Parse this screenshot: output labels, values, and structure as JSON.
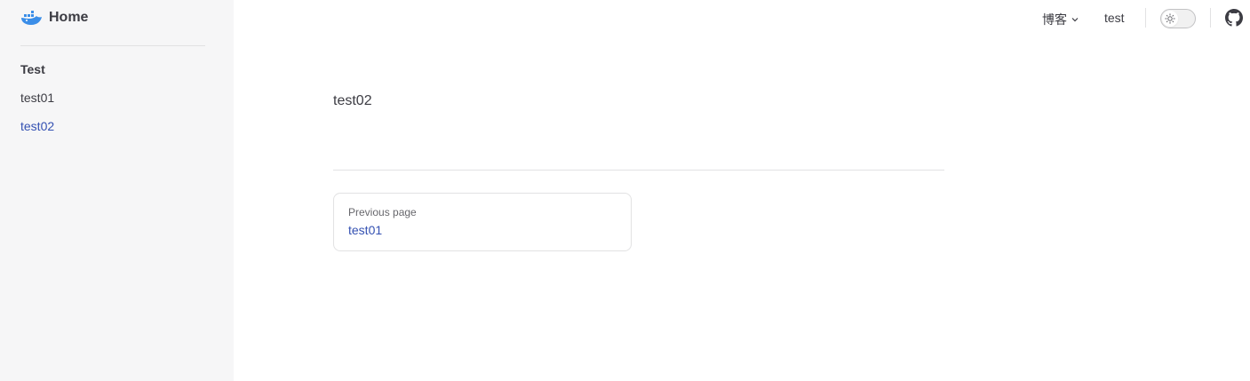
{
  "sidebar": {
    "logo_text": "Home",
    "group_title": "Test",
    "items": [
      {
        "label": "test01"
      },
      {
        "label": "test02"
      }
    ]
  },
  "navbar": {
    "blog_menu_label": "博客",
    "test_link_label": "test"
  },
  "doc": {
    "content": "test02"
  },
  "pager": {
    "prev_desc": "Previous page",
    "prev_title": "test01"
  },
  "colors": {
    "brand": "#3451b2",
    "sidebar_bg": "#f6f6f7",
    "divider": "#e2e2e3",
    "text": "#3c3c43"
  },
  "icons": {
    "logo": "whale-logo-icon",
    "dropdown": "chevron-down-icon",
    "theme": "sun-icon",
    "github": "github-icon"
  }
}
